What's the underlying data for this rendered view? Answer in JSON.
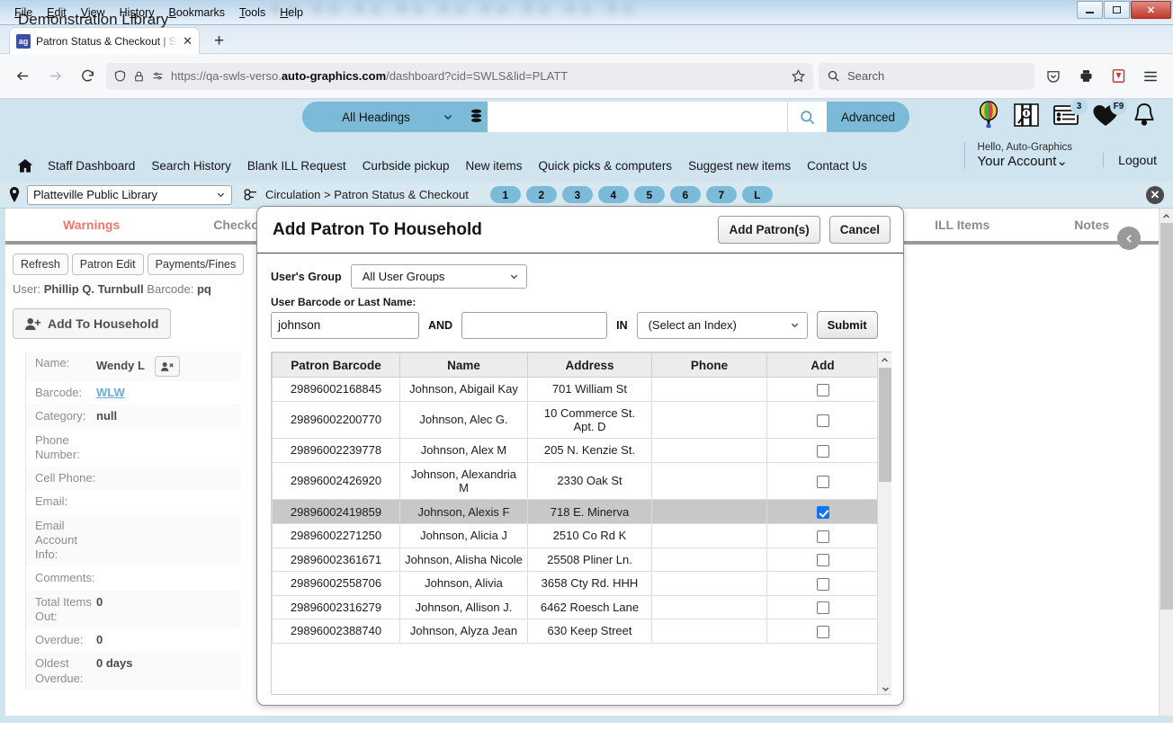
{
  "window": {
    "menus": [
      "File",
      "Edit",
      "View",
      "History",
      "Bookmarks",
      "Tools",
      "Help"
    ],
    "blurred_background_text": "Aa Aa Aa Aa Aa Aa Aa Aa Aa",
    "minimize_label": "Minimize",
    "maximize_label": "Maximize",
    "close_label": "✕"
  },
  "browser": {
    "tab_title": "Patron Status & Checkout | SWL",
    "tab_close": "✕",
    "new_tab": "+",
    "url_prefix": "https://qa-swls-verso.",
    "url_domain": "auto-graphics.com",
    "url_suffix": "/dashboard?cid=SWLS&lid=PLATT",
    "search_placeholder": "Search"
  },
  "site_header": {
    "library_name": "Demonstration Library",
    "headings_select": "All Headings",
    "search_value": "",
    "advanced_label": "Advanced",
    "list_badge": "3",
    "heart_badge": "F9",
    "greeting": "Hello, Auto-Graphics",
    "account_label": "Your Account",
    "logout_label": "Logout",
    "nav_links": [
      "Staff Dashboard",
      "Search History",
      "Blank ILL Request",
      "Curbside pickup",
      "New items",
      "Quick picks & computers",
      "Suggest new items",
      "Contact Us"
    ]
  },
  "location_bar": {
    "library_select": "Platteville Public Library",
    "breadcrumb": "Circulation > Patron Status & Checkout",
    "pills": [
      "1",
      "2",
      "3",
      "4",
      "5",
      "6",
      "7",
      "L"
    ],
    "close_label": "✕"
  },
  "page_tabs": [
    {
      "label": "Warnings",
      "active": true
    },
    {
      "label": "Checkout",
      "active": false
    },
    {
      "label": "ILL Items",
      "active": false
    },
    {
      "label": "Notes",
      "active": false
    }
  ],
  "patron_panel": {
    "buttons": [
      "Refresh",
      "Patron Edit",
      "Payments/Fines"
    ],
    "user_label": "User:",
    "user_name": "Phillip Q. Turnbull",
    "barcode_label": "Barcode:",
    "barcode_value": "pq",
    "add_to_household_label": "Add To Household",
    "fields": [
      {
        "key": "Name:",
        "value": "Wendy L",
        "has_avatar": true
      },
      {
        "key": "Barcode:",
        "value": "WLW",
        "is_link": true
      },
      {
        "key": "Category:",
        "value": "null"
      },
      {
        "key": "Phone Number:",
        "value": ""
      },
      {
        "key": "Cell Phone:",
        "value": ""
      },
      {
        "key": "Email:",
        "value": ""
      },
      {
        "key": "Email Account Info:",
        "value": ""
      },
      {
        "key": "Comments:",
        "value": ""
      },
      {
        "key": "Total Items Out:",
        "value": "0"
      },
      {
        "key": "Overdue:",
        "value": "0"
      },
      {
        "key": "Oldest Overdue:",
        "value": "0 days"
      }
    ]
  },
  "modal": {
    "title": "Add Patron To Household",
    "add_patrons_label": "Add Patron(s)",
    "cancel_label": "Cancel",
    "users_group_label": "User's Group",
    "users_group_value": "All User Groups",
    "barcode_or_name_label": "User Barcode or Last Name:",
    "query_value": "johnson",
    "and_label": "AND",
    "query2_value": "",
    "in_label": "IN",
    "index_value": "(Select an Index)",
    "submit_label": "Submit",
    "columns": [
      "Patron Barcode",
      "Name",
      "Address",
      "Phone",
      "Add"
    ],
    "rows": [
      {
        "barcode": "29896002168845",
        "name": "Johnson, Abigail Kay",
        "address": "701 William St",
        "phone": "",
        "checked": false,
        "selected": false
      },
      {
        "barcode": "29896002200770",
        "name": "Johnson, Alec G.",
        "address": "10 Commerce St. Apt. D",
        "phone": "",
        "checked": false,
        "selected": false
      },
      {
        "barcode": "29896002239778",
        "name": "Johnson, Alex M",
        "address": "205 N. Kenzie St.",
        "phone": "",
        "checked": false,
        "selected": false
      },
      {
        "barcode": "29896002426920",
        "name": "Johnson, Alexandria M",
        "address": "2330 Oak St",
        "phone": "",
        "checked": false,
        "selected": false
      },
      {
        "barcode": "29896002419859",
        "name": "Johnson, Alexis F",
        "address": "718 E. Minerva",
        "phone": "",
        "checked": true,
        "selected": true
      },
      {
        "barcode": "29896002271250",
        "name": "Johnson, Alicia J",
        "address": "2510 Co Rd K",
        "phone": "",
        "checked": false,
        "selected": false
      },
      {
        "barcode": "29896002361671",
        "name": "Johnson, Alisha Nicole",
        "address": "25508 Pliner Ln.",
        "phone": "",
        "checked": false,
        "selected": false
      },
      {
        "barcode": "29896002558706",
        "name": "Johnson, Alivia",
        "address": "3658 Cty Rd. HHH",
        "phone": "",
        "checked": false,
        "selected": false
      },
      {
        "barcode": "29896002316279",
        "name": "Johnson, Allison J.",
        "address": "6462 Roesch Lane",
        "phone": "",
        "checked": false,
        "selected": false
      },
      {
        "barcode": "29896002388740",
        "name": "Johnson, Alyza Jean",
        "address": "630 Keep Street",
        "phone": "",
        "checked": false,
        "selected": false
      }
    ]
  },
  "colors": {
    "header_bg": "#cfe4ef",
    "accent": "#7cbbd7",
    "active_tab": "#f4766a",
    "checkbox_checked": "#1474ef",
    "selected_row": "#c8c8c8"
  }
}
